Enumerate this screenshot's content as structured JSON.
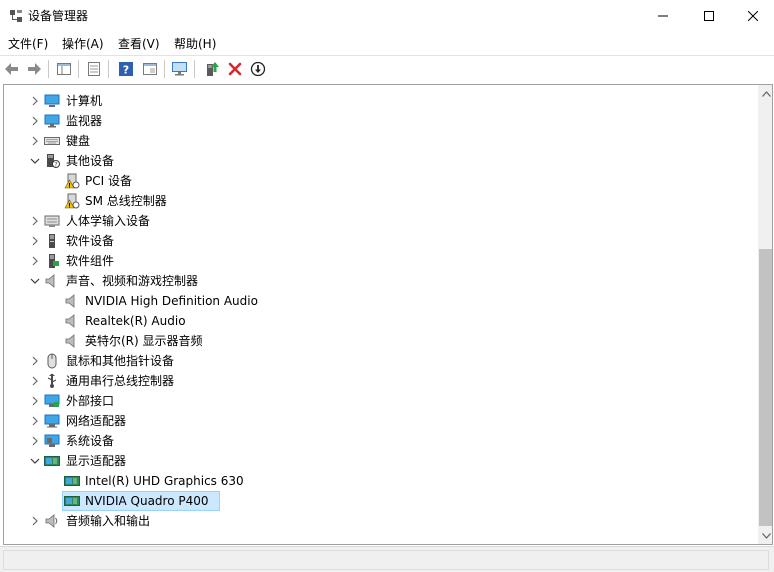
{
  "window": {
    "title": "设备管理器",
    "controls": [
      "minimize",
      "maximize",
      "close"
    ]
  },
  "menu": [
    "文件(F)",
    "操作(A)",
    "查看(V)",
    "帮助(H)"
  ],
  "toolbar": {
    "buttons": [
      "back-icon",
      "forward-icon",
      "properties-sheet-icon",
      "list-view-icon",
      "help-icon",
      "show-hidden-icon",
      "monitor-scan-icon",
      "update-driver-icon",
      "uninstall-icon",
      "disable-icon"
    ]
  },
  "tree": [
    {
      "label": "计算机",
      "icon": "computer-icon",
      "expanded": false
    },
    {
      "label": "监视器",
      "icon": "monitor-icon",
      "expanded": false
    },
    {
      "label": "键盘",
      "icon": "keyboard-icon",
      "expanded": false
    },
    {
      "label": "其他设备",
      "icon": "unknown-device-icon",
      "expanded": true
    },
    {
      "label": "PCI 设备",
      "icon": "warning-device-icon",
      "child": true
    },
    {
      "label": "SM 总线控制器",
      "icon": "warning-device-icon",
      "child": true
    },
    {
      "label": "人体学输入设备",
      "icon": "hid-icon",
      "expanded": false
    },
    {
      "label": "软件设备",
      "icon": "software-device-icon",
      "expanded": false
    },
    {
      "label": "软件组件",
      "icon": "software-component-icon",
      "expanded": false
    },
    {
      "label": "声音、视频和游戏控制器",
      "icon": "speaker-icon",
      "expanded": true
    },
    {
      "label": "NVIDIA High Definition Audio",
      "icon": "speaker-icon",
      "child": true
    },
    {
      "label": "Realtek(R) Audio",
      "icon": "speaker-icon",
      "child": true
    },
    {
      "label": "英特尔(R) 显示器音频",
      "icon": "speaker-icon",
      "child": true
    },
    {
      "label": "鼠标和其他指针设备",
      "icon": "mouse-icon",
      "expanded": false
    },
    {
      "label": "通用串行总线控制器",
      "icon": "usb-icon",
      "expanded": false
    },
    {
      "label": "外部接口",
      "icon": "port-icon",
      "expanded": false
    },
    {
      "label": "网络适配器",
      "icon": "network-icon",
      "expanded": false
    },
    {
      "label": "系统设备",
      "icon": "system-icon",
      "expanded": false
    },
    {
      "label": "显示适配器",
      "icon": "display-adapter-icon",
      "expanded": true
    },
    {
      "label": "Intel(R) UHD Graphics 630",
      "icon": "display-adapter-icon",
      "child": true
    },
    {
      "label": "NVIDIA Quadro P400",
      "icon": "display-adapter-icon",
      "child": true,
      "selected": true
    },
    {
      "label": "音频输入和输出",
      "icon": "audio-io-icon",
      "expanded": false
    }
  ],
  "colors": {
    "selection": "#cce8ff",
    "selection_border": "#99d1ff",
    "accent_blue": "#1e6fc6",
    "error_red": "#d9272e"
  },
  "statusbar": {
    "text": ""
  }
}
